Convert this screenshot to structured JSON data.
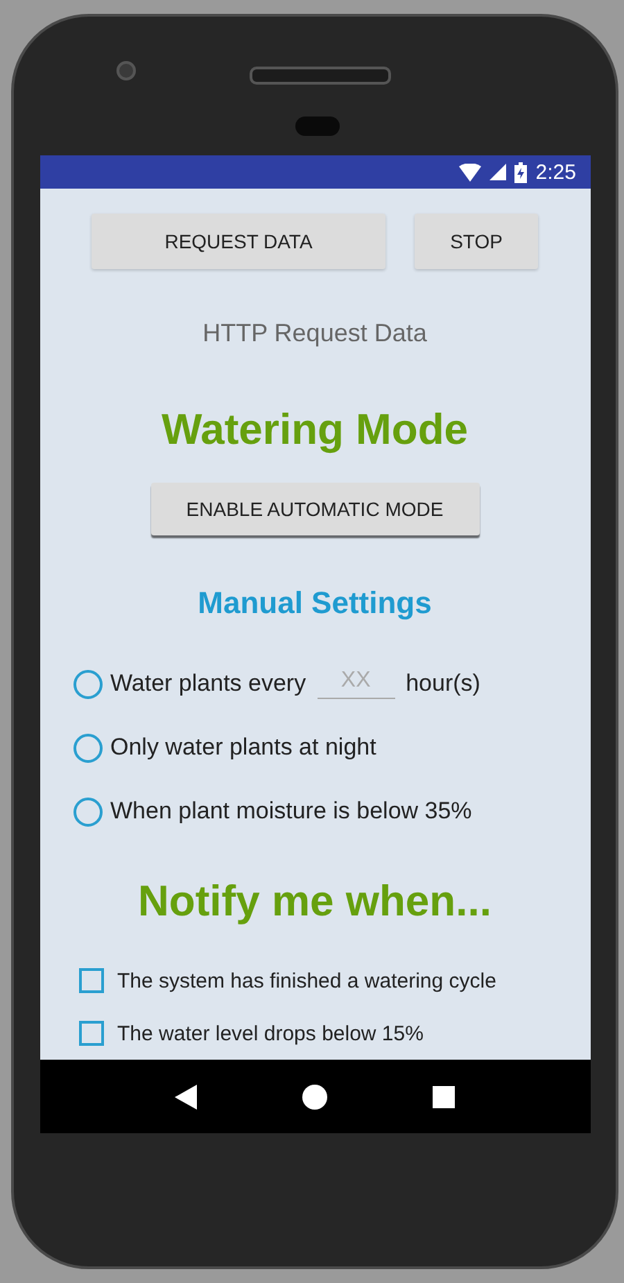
{
  "status_bar": {
    "time": "2:25"
  },
  "top_buttons": [
    "REQUEST DATA",
    "STOP"
  ],
  "response_text": "HTTP Request Data",
  "watering_title": "Watering Mode",
  "automatic_button": "ENABLE AUTOMATIC MODE",
  "manual_title": "Manual Settings",
  "manual_options": [
    {
      "kind": "interval",
      "label": "Water plants every",
      "placeholder": "XX",
      "unit": "hour(s)",
      "selected": false
    },
    {
      "kind": "plain",
      "label": "Only water plants at night",
      "selected": false
    },
    {
      "kind": "plain",
      "label": "When plant moisture is below 35%",
      "selected": false
    }
  ],
  "notify_title": "Notify me when...",
  "notifications": [
    {
      "label": "The system has finished a watering cycle",
      "checked": false
    },
    {
      "label": "The water level drops below 15%",
      "checked": false
    }
  ]
}
